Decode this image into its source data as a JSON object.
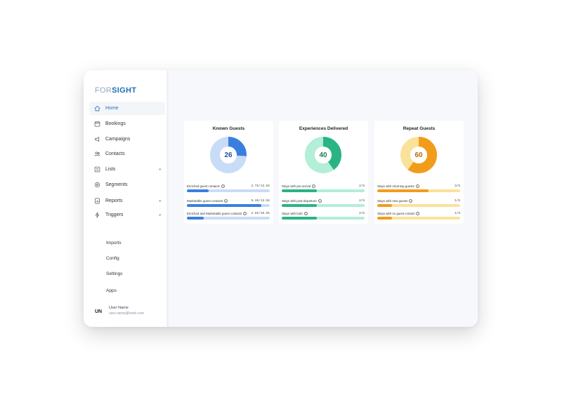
{
  "logo": {
    "part1": "FOR",
    "part2": "SIGHT"
  },
  "sidebar": {
    "items": [
      {
        "key": "home",
        "label": "Home",
        "icon": "home-icon",
        "active": true,
        "caret": ""
      },
      {
        "key": "bookings",
        "label": "Bookings",
        "icon": "calendar-icon",
        "active": false,
        "caret": ""
      },
      {
        "key": "campaigns",
        "label": "Campaigns",
        "icon": "megaphone-icon",
        "active": false,
        "caret": ""
      },
      {
        "key": "contacts",
        "label": "Contacts",
        "icon": "people-icon",
        "active": false,
        "caret": ""
      },
      {
        "key": "lists",
        "label": "Lists",
        "icon": "list-icon",
        "active": false,
        "caret": "▾"
      },
      {
        "key": "segments",
        "label": "Segments",
        "icon": "segments-icon",
        "active": false,
        "caret": ""
      },
      {
        "key": "reports",
        "label": "Reports",
        "icon": "report-icon",
        "active": false,
        "caret": "▾"
      },
      {
        "key": "triggers",
        "label": "Triggers",
        "icon": "lightning-icon",
        "active": false,
        "caret": "▾"
      }
    ],
    "sub_items": [
      "Imports",
      "Config",
      "Settings",
      "Apps"
    ],
    "user": {
      "initials": "UN",
      "name": "User Name",
      "email": "user.name@hotel.com"
    }
  },
  "cards": [
    {
      "title": "Known Guests",
      "value": "26",
      "percent": 26,
      "colors": {
        "main": "#3a7fe0",
        "light": "#c9dcf7",
        "text": "#1f4f99"
      },
      "metrics": [
        {
          "label": "Enriched guest contacts",
          "value": "2.7k/13.5k",
          "fill": 0.26
        },
        {
          "label": "Marketable guest contacts",
          "value": "9.3k/13.5k",
          "fill": 0.9
        },
        {
          "label": "Enriched and Marketable guest contacts",
          "value": "2.6k/10.5k",
          "fill": 0.2
        }
      ]
    },
    {
      "title": "Experiences Delivered",
      "value": "40",
      "percent": 40,
      "colors": {
        "main": "#2bb383",
        "light": "#b3eed6",
        "text": "#1c7a55"
      },
      "metrics": [
        {
          "label": "Stays with pre-arrival",
          "value": "2/5",
          "fill": 0.42
        },
        {
          "label": "Stays with post-departure",
          "value": "2/5",
          "fill": 0.42
        },
        {
          "label": "Stays with both",
          "value": "2/5",
          "fill": 0.42
        }
      ]
    },
    {
      "title": "Repeat Guests",
      "value": "60",
      "percent": 60,
      "colors": {
        "main": "#f29c1c",
        "light": "#fbe29a",
        "text": "#b86d00"
      },
      "metrics": [
        {
          "label": "Stays with returning guests",
          "value": "3/5",
          "fill": 0.62
        },
        {
          "label": "Stays with new guests",
          "value": "1/5",
          "fill": 0.18
        },
        {
          "label": "Stays with no guest contact",
          "value": "1/5",
          "fill": 0.18
        }
      ]
    }
  ]
}
